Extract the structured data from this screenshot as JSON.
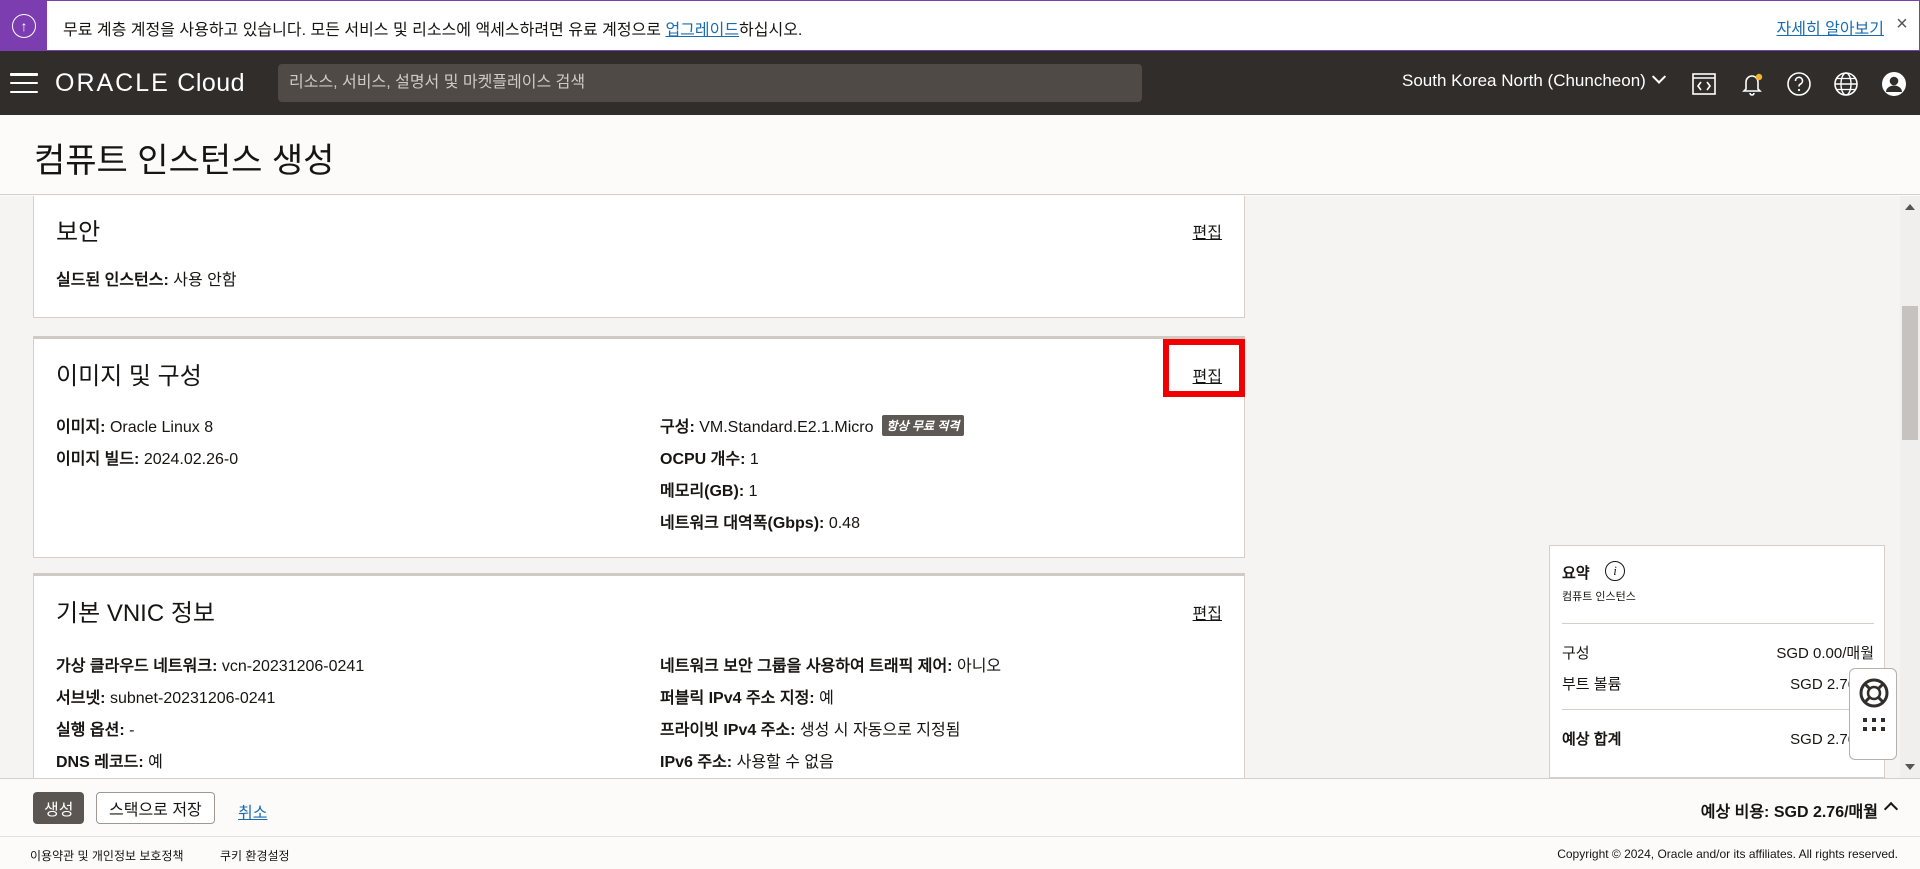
{
  "banner": {
    "message_before": "무료 계층 계정을 사용하고 있습니다. 모든 서비스 및 리소스에 액세스하려면 유료 계정으로 ",
    "upgrade_link": "업그레이드",
    "message_after": "하십시오.",
    "learn_more": "자세히 알아보기",
    "close_icon": "×",
    "accent_color": "#7b3db0"
  },
  "header": {
    "logo_brand": "ORACLE",
    "logo_product": "Cloud",
    "search_placeholder": "리소스, 서비스, 설명서 및 마켓플레이스 검색",
    "region": "South Korea North (Chuncheon)",
    "icons": [
      "code-editor-icon",
      "bell-icon",
      "help-icon",
      "globe-icon",
      "user-icon"
    ]
  },
  "page": {
    "title": "컴퓨트 인스턴스 생성"
  },
  "sections": {
    "security": {
      "title": "보안",
      "edit": "편집",
      "shielded_label": "실드된 인스턴스:",
      "shielded_value": "사용 안함"
    },
    "image": {
      "title": "이미지 및 구성",
      "edit": "편집",
      "image_label": "이미지:",
      "image_value": "Oracle Linux 8",
      "build_label": "이미지 빌드:",
      "build_value": "2024.02.26-0",
      "shape_label": "구성:",
      "shape_value": "VM.Standard.E2.1.Micro",
      "shape_badge": "항상 무료 적격",
      "ocpu_label": "OCPU 개수:",
      "ocpu_value": "1",
      "memory_label": "메모리(GB):",
      "memory_value": "1",
      "bandwidth_label": "네트워크 대역폭(Gbps):",
      "bandwidth_value": "0.48"
    },
    "vnic": {
      "title": "기본 VNIC 정보",
      "edit": "편집",
      "vcn_label": "가상 클라우드 네트워크:",
      "vcn_value": "vcn-20231206-0241",
      "subnet_label": "서브넷:",
      "subnet_value": "subnet-20231206-0241",
      "launch_label": "실행 옵션:",
      "launch_value": "-",
      "dns_label": "DNS 레코드:",
      "dns_value": "예",
      "nsg_label": "네트워크 보안 그룹을 사용하여 트래픽 제어:",
      "nsg_value": "아니오",
      "public_ip_label": "퍼블릭 IPv4 주소 지정:",
      "public_ip_value": "예",
      "private_ip_label": "프라이빗 IPv4 주소:",
      "private_ip_value": "생성 시 자동으로 지정됨",
      "ipv6_label": "IPv6 주소:",
      "ipv6_value": "사용할 수 없음"
    }
  },
  "summary": {
    "title": "요약",
    "subtitle": "컴퓨트 인스턴스",
    "rows": [
      {
        "label": "구성",
        "value": "SGD 0.00/매월"
      },
      {
        "label": "부트 볼륨",
        "value": "SGD 2.76/매"
      }
    ],
    "total_label": "예상 합계",
    "total_value": "SGD 2.76/매"
  },
  "actions": {
    "create": "생성",
    "save_stack": "스택으로 저장",
    "cancel": "취소",
    "estimated_cost_label": "예상 비용:",
    "estimated_cost_value": "SGD 2.76/매월"
  },
  "footer": {
    "terms": "이용약관 및 개인정보 보호정책",
    "cookies": "쿠키 환경설정",
    "copyright": "Copyright © 2024, Oracle and/or its affiliates. All rights reserved."
  }
}
